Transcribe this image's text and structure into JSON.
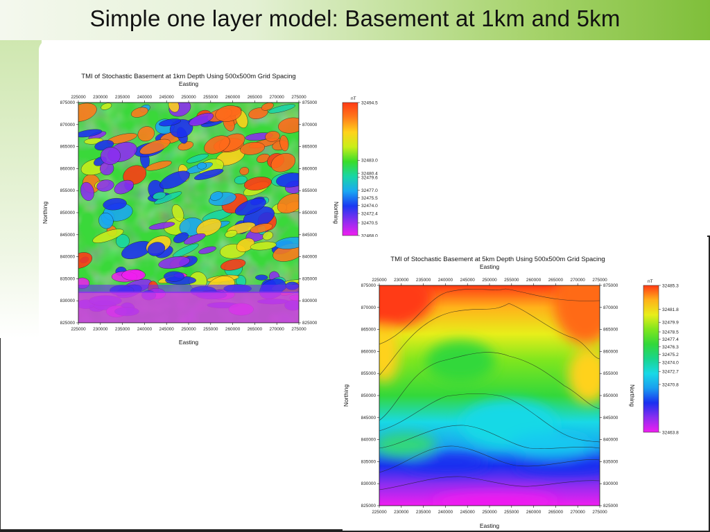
{
  "slide": {
    "title": "Simple one layer model: Basement at 1km and 5km"
  },
  "map1": {
    "title": "TMI of Stochastic Basement at 1km Depth Using 500x500m Grid Spacing",
    "x_label": "Easting",
    "y_label": "Northing",
    "unit": "nT",
    "x_ticks": [
      "225000",
      "230000",
      "235000",
      "240000",
      "245000",
      "250000",
      "255000",
      "260000",
      "265000",
      "270000",
      "275000"
    ],
    "y_ticks": [
      "875000",
      "870000",
      "865000",
      "860000",
      "855000",
      "850000",
      "845000",
      "840000",
      "835000",
      "830000",
      "825000"
    ],
    "colorbar_labels": [
      "32494.5",
      "32483.0",
      "32480.4",
      "32479.6",
      "32477.0",
      "32475.5",
      "32474.0",
      "32472.4",
      "32470.5",
      "32468.0"
    ],
    "colorbar_values": [
      32494.5,
      32483.0,
      32480.4,
      32479.6,
      32477.0,
      32475.5,
      32474.0,
      32472.4,
      32470.5,
      32468.0
    ],
    "colors": [
      "#ff3a14",
      "#ff7a1a",
      "#ffd21a",
      "#c9ee1a",
      "#39dd2a",
      "#19d6a6",
      "#1aa8f2",
      "#1a39f2",
      "#8a2ef0",
      "#f01ef0"
    ]
  },
  "map2": {
    "title": "TMI of Stochastic Basement at 5km Depth Using 500x500m Grid Spacing",
    "x_label": "Easting",
    "y_label": "Northing",
    "unit": "nT",
    "x_ticks": [
      "225000",
      "230000",
      "235000",
      "240000",
      "245000",
      "250000",
      "255000",
      "260000",
      "265000",
      "270000",
      "275000"
    ],
    "y_ticks": [
      "875000",
      "870000",
      "865000",
      "860000",
      "855000",
      "850000",
      "845000",
      "840000",
      "835000",
      "830000",
      "825000"
    ],
    "colorbar_labels": [
      "32485.3",
      "32481.8",
      "32479.9",
      "32478.5",
      "32477.4",
      "32476.3",
      "32475.2",
      "32474.0",
      "32472.7",
      "32470.8",
      "32463.8"
    ],
    "colorbar_values": [
      32485.3,
      32481.8,
      32479.9,
      32478.5,
      32477.4,
      32476.3,
      32475.2,
      32474.0,
      32472.7,
      32470.8,
      32463.8
    ],
    "colors": [
      "#ff3a14",
      "#ffb21a",
      "#e8ee1a",
      "#7fe61e",
      "#33d83a",
      "#1ad58c",
      "#19d9e6",
      "#1a9ef0",
      "#1a2ff0",
      "#8a2ef0",
      "#f01ef0"
    ]
  }
}
